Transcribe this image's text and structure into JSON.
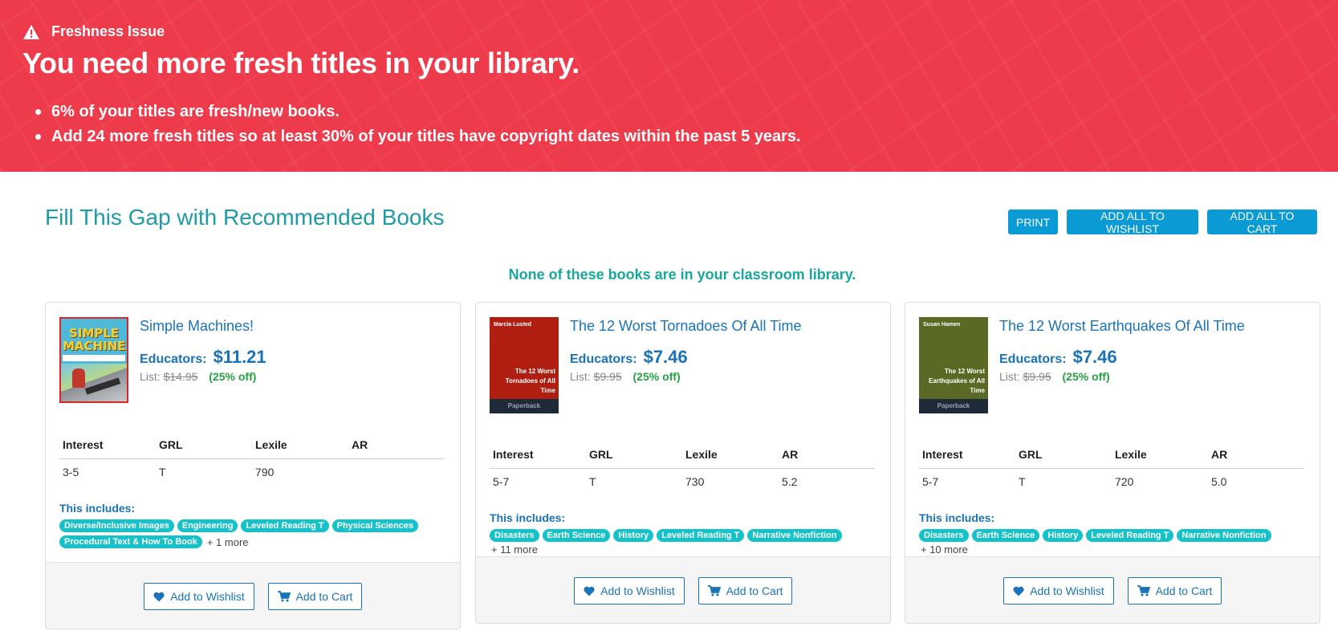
{
  "banner": {
    "issue_label": "Freshness Issue",
    "title": "You need more fresh titles in your library.",
    "bullets": [
      "6% of your titles are fresh/new books.",
      "Add 24 more fresh titles so at least 30% of your titles have copyright dates within the past 5 years."
    ],
    "background_color": "#ee3b4b"
  },
  "section": {
    "title": "Fill This Gap with Recommended Books",
    "buttons": {
      "print": "PRINT",
      "add_all_wishlist": "ADD ALL TO WISHLIST",
      "add_all_cart": "ADD ALL TO CART"
    },
    "none_message": "None of these books are in your classroom library."
  },
  "table_headers": {
    "interest": "Interest",
    "grl": "GRL",
    "lexile": "Lexile",
    "ar": "AR"
  },
  "labels": {
    "educators": "Educators:",
    "list": "List:",
    "includes": "This includes:",
    "add_wishlist": "Add to Wishlist",
    "add_cart": "Add to Cart"
  },
  "books": [
    {
      "title": "Simple Machines!",
      "educator_price": "$11.21",
      "list_price": "$14.95",
      "discount": "(25% off)",
      "cover": {
        "title": "SIMPLE MACHINES!"
      },
      "interest": "3-5",
      "grl": "T",
      "lexile": "790",
      "ar": "",
      "tags": [
        "Diverse/Inclusive Images",
        "Engineering",
        "Leveled Reading T",
        "Physical Sciences",
        "Procedural Text & How To Book"
      ],
      "more": "+ 1 more"
    },
    {
      "title": "The 12 Worst Tornadoes Of All Time",
      "educator_price": "$7.46",
      "list_price": "$9.95",
      "discount": "(25% off)",
      "cover": {
        "author": "Marcia Lusted",
        "title": "The 12 Worst Tornadoes of All Time",
        "format": "Paperback"
      },
      "interest": "5-7",
      "grl": "T",
      "lexile": "730",
      "ar": "5.2",
      "tags": [
        "Disasters",
        "Earth Science",
        "History",
        "Leveled Reading T",
        "Narrative Nonfiction"
      ],
      "more": "+ 11 more"
    },
    {
      "title": "The 12 Worst Earthquakes Of All Time",
      "educator_price": "$7.46",
      "list_price": "$9.95",
      "discount": "(25% off)",
      "cover": {
        "author": "Susan Hamen",
        "title": "The 12 Worst Earthquakes of All Time",
        "format": "Paperback"
      },
      "interest": "5-7",
      "grl": "T",
      "lexile": "720",
      "ar": "5.0",
      "tags": [
        "Disasters",
        "Earth Science",
        "History",
        "Leveled Reading T",
        "Narrative Nonfiction"
      ],
      "more": "+ 10 more"
    }
  ],
  "colors": {
    "accent": "#0a9ad4",
    "link": "#1a73b8",
    "teal": "#1f9aa8",
    "tag": "#16c2c9",
    "discount": "#27a045"
  },
  "icons": [
    "warning-icon",
    "heart-icon",
    "cart-icon"
  ]
}
